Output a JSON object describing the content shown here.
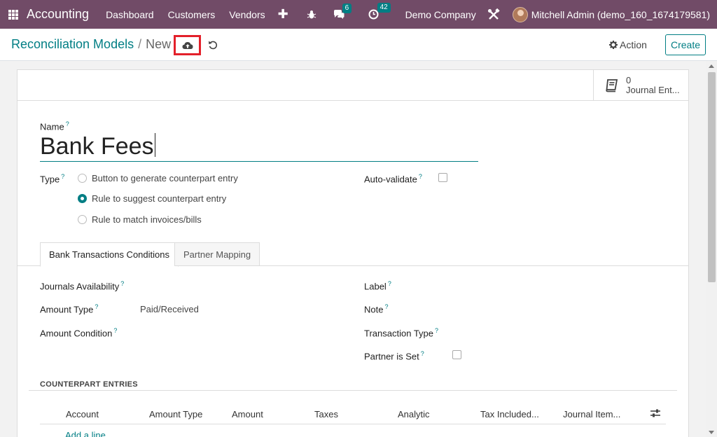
{
  "navbar": {
    "app_name": "Accounting",
    "menu": [
      "Dashboard",
      "Customers",
      "Vendors"
    ],
    "new_icon": "plus-icon",
    "messages_count": "6",
    "activities_count": "42",
    "company": "Demo Company",
    "user": "Mitchell Admin (demo_160_1674179581)"
  },
  "control": {
    "breadcrumb_parent": "Reconciliation Models",
    "breadcrumb_sep": "/",
    "breadcrumb_current": "New",
    "action_label": "Action",
    "create_label": "Create"
  },
  "form": {
    "stat_count": "0",
    "stat_label": "Journal Ent...",
    "name_label": "Name",
    "name_value": "Bank Fees",
    "help_mark": "?",
    "type_label": "Type",
    "type_options": [
      "Button to generate counterpart entry",
      "Rule to suggest counterpart entry",
      "Rule to match invoices/bills"
    ],
    "type_selected": "Rule to suggest counterpart entry",
    "auto_validate_label": "Auto-validate",
    "tabs": [
      "Bank Transactions Conditions",
      "Partner Mapping"
    ],
    "left_fields": {
      "journals": "Journals Availability",
      "amount_type": "Amount Type",
      "amount_type_value": "Paid/Received",
      "amount_condition": "Amount Condition"
    },
    "right_fields": {
      "label": "Label",
      "note": "Note",
      "transaction_type": "Transaction Type",
      "partner_is_set": "Partner is Set"
    },
    "counterpart_title": "COUNTERPART ENTRIES",
    "columns": [
      "Account",
      "Amount Type",
      "Amount",
      "Taxes",
      "Analytic",
      "Tax Included...",
      "Journal Item..."
    ],
    "add_line": "Add a line"
  },
  "colors": {
    "navbar": "#714b67",
    "accent": "#017e84",
    "highlight": "#e3202a"
  }
}
